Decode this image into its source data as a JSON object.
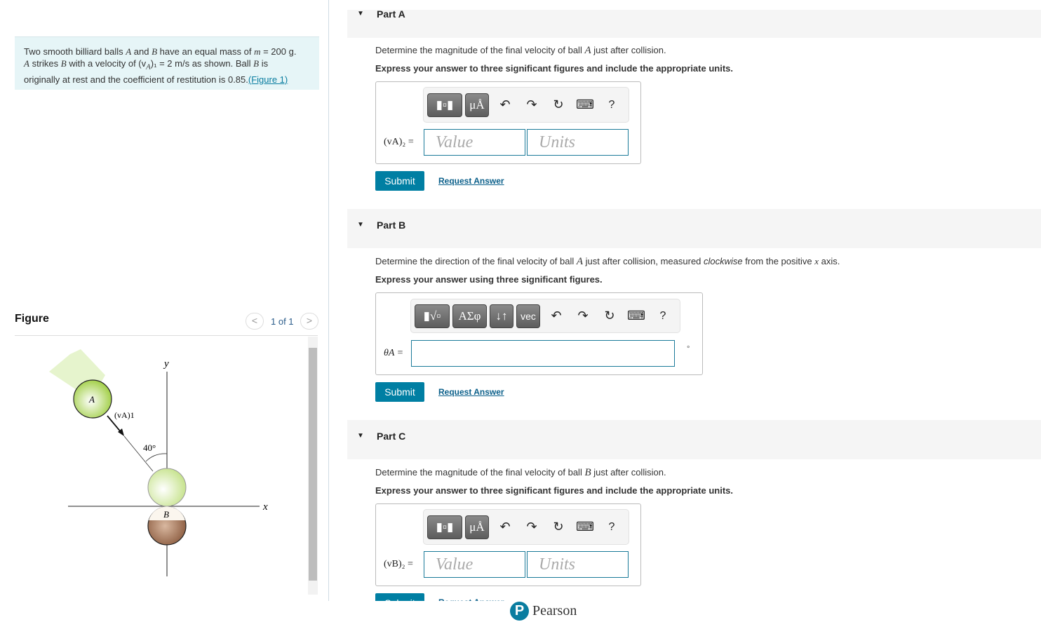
{
  "problem": {
    "text_1": "Two smooth billiard balls ",
    "A": "A",
    "text_2": " and ",
    "B": "B",
    "text_3": " have an equal mass of ",
    "m": "m",
    "text_4": " = 200 g.",
    "line2_A": "A",
    "text_5": " strikes ",
    "line2_B": "B",
    "text_6": " with a velocity of (v",
    "sub_A": "A",
    "text_7": ")₁ = 2 m/s as shown. Ball ",
    "line2_B2": "B",
    "text_8": " is",
    "line3": "originally at rest and the coefficient of restitution is 0.85.",
    "figure_link": "(Figure 1)"
  },
  "figure": {
    "title": "Figure",
    "count": "1 of 1",
    "prev": "<",
    "next": ">",
    "labels": {
      "y": "y",
      "x": "x",
      "A": "A",
      "B": "B",
      "velocity": "(vA)1",
      "angle": "40°"
    }
  },
  "parts": [
    {
      "label": "Part A",
      "question_1": "Determine the magnitude of the final velocity of ball ",
      "question_var": "A",
      "question_2": " just after collision.",
      "instruction": "Express your answer to three significant figures and include the appropriate units.",
      "variable": "(vA)₂ =",
      "value_placeholder": "Value",
      "units_placeholder": "Units",
      "submit": "Submit",
      "request": "Request Answer"
    },
    {
      "label": "Part B",
      "question_1": "Determine the direction of the final velocity of ball ",
      "question_var": "A",
      "question_2": " just after collision, measured ",
      "question_em": "clockwise",
      "question_3": " from the positive ",
      "question_var2": "x",
      "question_4": " axis.",
      "instruction": "Express your answer using three significant figures.",
      "variable": "θA =",
      "unit": "°",
      "tools": [
        "ΑΣφ",
        "↓↑",
        "vec"
      ],
      "submit": "Submit",
      "request": "Request Answer"
    },
    {
      "label": "Part C",
      "question_1": "Determine the magnitude of the final velocity of ball ",
      "question_var": "B",
      "question_2": " just after collision.",
      "instruction": "Express your answer to three significant figures and include the appropriate units.",
      "variable": "(vB)₂ =",
      "value_placeholder": "Value",
      "units_placeholder": "Units",
      "submit": "Submit",
      "request": "Request Answer"
    }
  ],
  "toolbar": {
    "units_btn": "μÅ",
    "undo": "↶",
    "redo": "↷",
    "reset": "↻",
    "keyboard": "⌨",
    "help": "?"
  },
  "footer": {
    "brand": "Pearson",
    "logo_letter": "P"
  },
  "colors": {
    "accent": "#007fa3",
    "problem_bg": "#e6f5f7",
    "part_bg": "#f5f5f5"
  }
}
